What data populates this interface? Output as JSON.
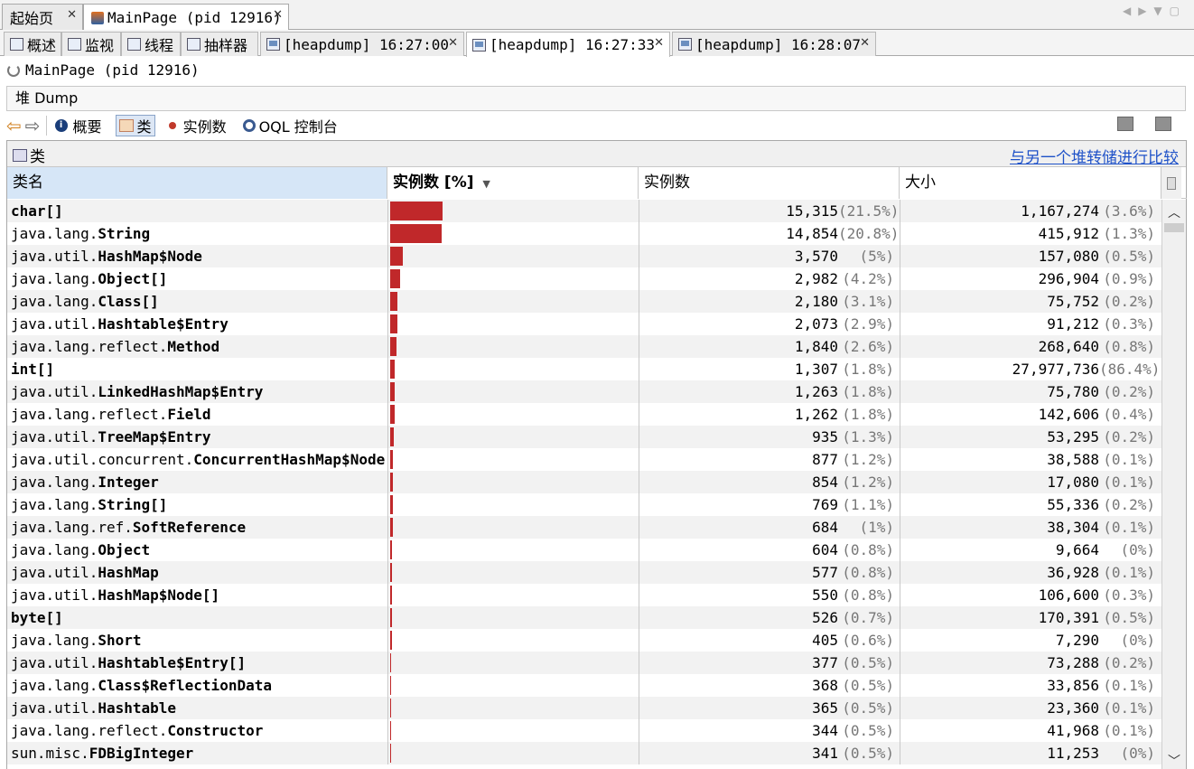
{
  "doc_tabs": [
    {
      "label": "起始页",
      "active": false
    },
    {
      "label": "MainPage (pid 12916)",
      "active": true
    }
  ],
  "sub_tabs": [
    {
      "label": "概述",
      "icon": "overview-icon"
    },
    {
      "label": "监视",
      "icon": "monitor-icon"
    },
    {
      "label": "线程",
      "icon": "threads-icon"
    },
    {
      "label": "抽样器",
      "icon": "sampler-icon"
    },
    {
      "label": "[heapdump] 16:27:00",
      "icon": "heapdump-icon"
    },
    {
      "label": "[heapdump] 16:27:33",
      "icon": "heapdump-icon",
      "active": true
    },
    {
      "label": "[heapdump] 16:28:07",
      "icon": "heapdump-icon"
    }
  ],
  "process_title": "MainPage (pid 12916)",
  "heapdump_label": "堆 Dump",
  "toolbar": {
    "summary": "概要",
    "classes": "类",
    "instances": "实例数",
    "oql": "OQL 控制台"
  },
  "panel": {
    "title": "类",
    "compare_link": "与另一个堆转储进行比较"
  },
  "columns": {
    "name": "类名",
    "instances_pct": "实例数 [%]",
    "instances": "实例数",
    "size": "大小"
  },
  "rows": [
    {
      "pkg": "",
      "cls": "char[]",
      "count": "15,315",
      "count_pct": "(21.5%)",
      "size": "1,167,274",
      "size_pct": "(3.6%)",
      "frac": 0.215
    },
    {
      "pkg": "java.lang.",
      "cls": "String",
      "count": "14,854",
      "count_pct": "(20.8%)",
      "size": "415,912",
      "size_pct": "(1.3%)",
      "frac": 0.208
    },
    {
      "pkg": "java.util.",
      "cls": "HashMap$Node",
      "count": "3,570",
      "count_pct": "(5%)",
      "size": "157,080",
      "size_pct": "(0.5%)",
      "frac": 0.05
    },
    {
      "pkg": "java.lang.",
      "cls": "Object[]",
      "count": "2,982",
      "count_pct": "(4.2%)",
      "size": "296,904",
      "size_pct": "(0.9%)",
      "frac": 0.042
    },
    {
      "pkg": "java.lang.",
      "cls": "Class[]",
      "count": "2,180",
      "count_pct": "(3.1%)",
      "size": "75,752",
      "size_pct": "(0.2%)",
      "frac": 0.031
    },
    {
      "pkg": "java.util.",
      "cls": "Hashtable$Entry",
      "count": "2,073",
      "count_pct": "(2.9%)",
      "size": "91,212",
      "size_pct": "(0.3%)",
      "frac": 0.029
    },
    {
      "pkg": "java.lang.reflect.",
      "cls": "Method",
      "count": "1,840",
      "count_pct": "(2.6%)",
      "size": "268,640",
      "size_pct": "(0.8%)",
      "frac": 0.026
    },
    {
      "pkg": "",
      "cls": "int[]",
      "count": "1,307",
      "count_pct": "(1.8%)",
      "size": "27,977,736",
      "size_pct": "(86.4%)",
      "frac": 0.018
    },
    {
      "pkg": "java.util.",
      "cls": "LinkedHashMap$Entry",
      "count": "1,263",
      "count_pct": "(1.8%)",
      "size": "75,780",
      "size_pct": "(0.2%)",
      "frac": 0.018
    },
    {
      "pkg": "java.lang.reflect.",
      "cls": "Field",
      "count": "1,262",
      "count_pct": "(1.8%)",
      "size": "142,606",
      "size_pct": "(0.4%)",
      "frac": 0.018
    },
    {
      "pkg": "java.util.",
      "cls": "TreeMap$Entry",
      "count": "935",
      "count_pct": "(1.3%)",
      "size": "53,295",
      "size_pct": "(0.2%)",
      "frac": 0.013
    },
    {
      "pkg": "java.util.concurrent.",
      "cls": "ConcurrentHashMap$Node",
      "count": "877",
      "count_pct": "(1.2%)",
      "size": "38,588",
      "size_pct": "(0.1%)",
      "frac": 0.012
    },
    {
      "pkg": "java.lang.",
      "cls": "Integer",
      "count": "854",
      "count_pct": "(1.2%)",
      "size": "17,080",
      "size_pct": "(0.1%)",
      "frac": 0.012
    },
    {
      "pkg": "java.lang.",
      "cls": "String[]",
      "count": "769",
      "count_pct": "(1.1%)",
      "size": "55,336",
      "size_pct": "(0.2%)",
      "frac": 0.011
    },
    {
      "pkg": "java.lang.ref.",
      "cls": "SoftReference",
      "count": "684",
      "count_pct": "(1%)",
      "size": "38,304",
      "size_pct": "(0.1%)",
      "frac": 0.01
    },
    {
      "pkg": "java.lang.",
      "cls": "Object",
      "count": "604",
      "count_pct": "(0.8%)",
      "size": "9,664",
      "size_pct": "(0%)",
      "frac": 0.008
    },
    {
      "pkg": "java.util.",
      "cls": "HashMap",
      "count": "577",
      "count_pct": "(0.8%)",
      "size": "36,928",
      "size_pct": "(0.1%)",
      "frac": 0.008
    },
    {
      "pkg": "java.util.",
      "cls": "HashMap$Node[]",
      "count": "550",
      "count_pct": "(0.8%)",
      "size": "106,600",
      "size_pct": "(0.3%)",
      "frac": 0.008
    },
    {
      "pkg": "",
      "cls": "byte[]",
      "count": "526",
      "count_pct": "(0.7%)",
      "size": "170,391",
      "size_pct": "(0.5%)",
      "frac": 0.007
    },
    {
      "pkg": "java.lang.",
      "cls": "Short",
      "count": "405",
      "count_pct": "(0.6%)",
      "size": "7,290",
      "size_pct": "(0%)",
      "frac": 0.006
    },
    {
      "pkg": "java.util.",
      "cls": "Hashtable$Entry[]",
      "count": "377",
      "count_pct": "(0.5%)",
      "size": "73,288",
      "size_pct": "(0.2%)",
      "frac": 0.005
    },
    {
      "pkg": "java.lang.",
      "cls": "Class$ReflectionData",
      "count": "368",
      "count_pct": "(0.5%)",
      "size": "33,856",
      "size_pct": "(0.1%)",
      "frac": 0.005
    },
    {
      "pkg": "java.util.",
      "cls": "Hashtable",
      "count": "365",
      "count_pct": "(0.5%)",
      "size": "23,360",
      "size_pct": "(0.1%)",
      "frac": 0.005
    },
    {
      "pkg": "java.lang.reflect.",
      "cls": "Constructor",
      "count": "344",
      "count_pct": "(0.5%)",
      "size": "41,968",
      "size_pct": "(0.1%)",
      "frac": 0.005
    },
    {
      "pkg": "sun.misc.",
      "cls": "FDBigInteger",
      "count": "341",
      "count_pct": "(0.5%)",
      "size": "11,253",
      "size_pct": "(0%)",
      "frac": 0.005
    }
  ],
  "bar_color": "#c0282a",
  "link_color": "#1f52c8"
}
